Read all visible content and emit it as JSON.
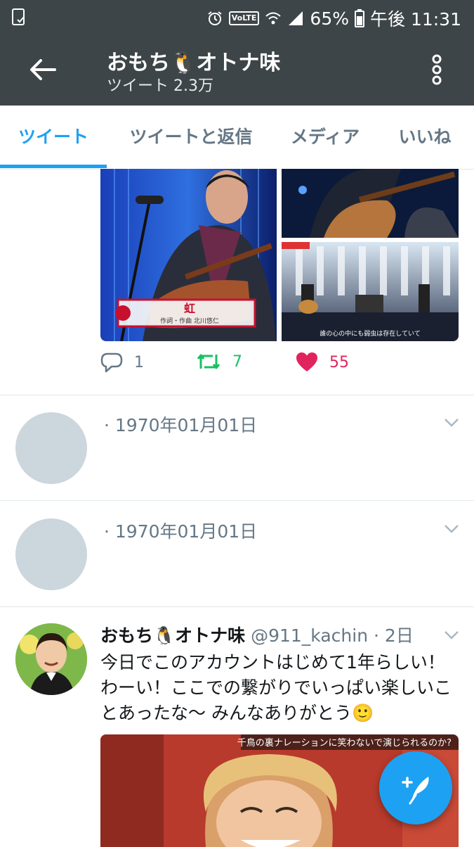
{
  "status_bar": {
    "battery": "65%",
    "time": "午後 11:31",
    "network_badge": "VoLTE"
  },
  "header": {
    "title": "おもち🐧オトナ味",
    "subtitle": "ツイート 2.3万"
  },
  "tabs": [
    {
      "label": "ツイート",
      "active": true
    },
    {
      "label": "ツイートと返信",
      "active": false
    },
    {
      "label": "メディア",
      "active": false
    },
    {
      "label": "いいね",
      "active": false
    }
  ],
  "media": {
    "caption_title": "虹",
    "caption_credit": "作詞・作曲 北川悠仁",
    "subtitle_text": "誰の心の中にも弱虫は存在していて"
  },
  "actions": {
    "reply_count": "1",
    "retweet_count": "7",
    "like_count": "55"
  },
  "placeholder_tweets": [
    {
      "date": "· 1970年01月01日"
    },
    {
      "date": "· 1970年01月01日"
    }
  ],
  "tweet": {
    "name": "おもち🐧オトナ味",
    "handle": "@911_kachin",
    "time": "· 2日",
    "text": "今日でこのアカウントはじめて1年らしい！わーい！ここでの繋がりでいっぱい楽しいことあったな〜 みんなありがとう🙂",
    "photo_caption": "千鳥の裏ナレーションに笑わないで演じられるのか?"
  },
  "colors": {
    "header_bg": "#3d4548",
    "accent": "#1da1f2",
    "retweet": "#17bf63",
    "like": "#e0245e",
    "muted": "#657786"
  }
}
